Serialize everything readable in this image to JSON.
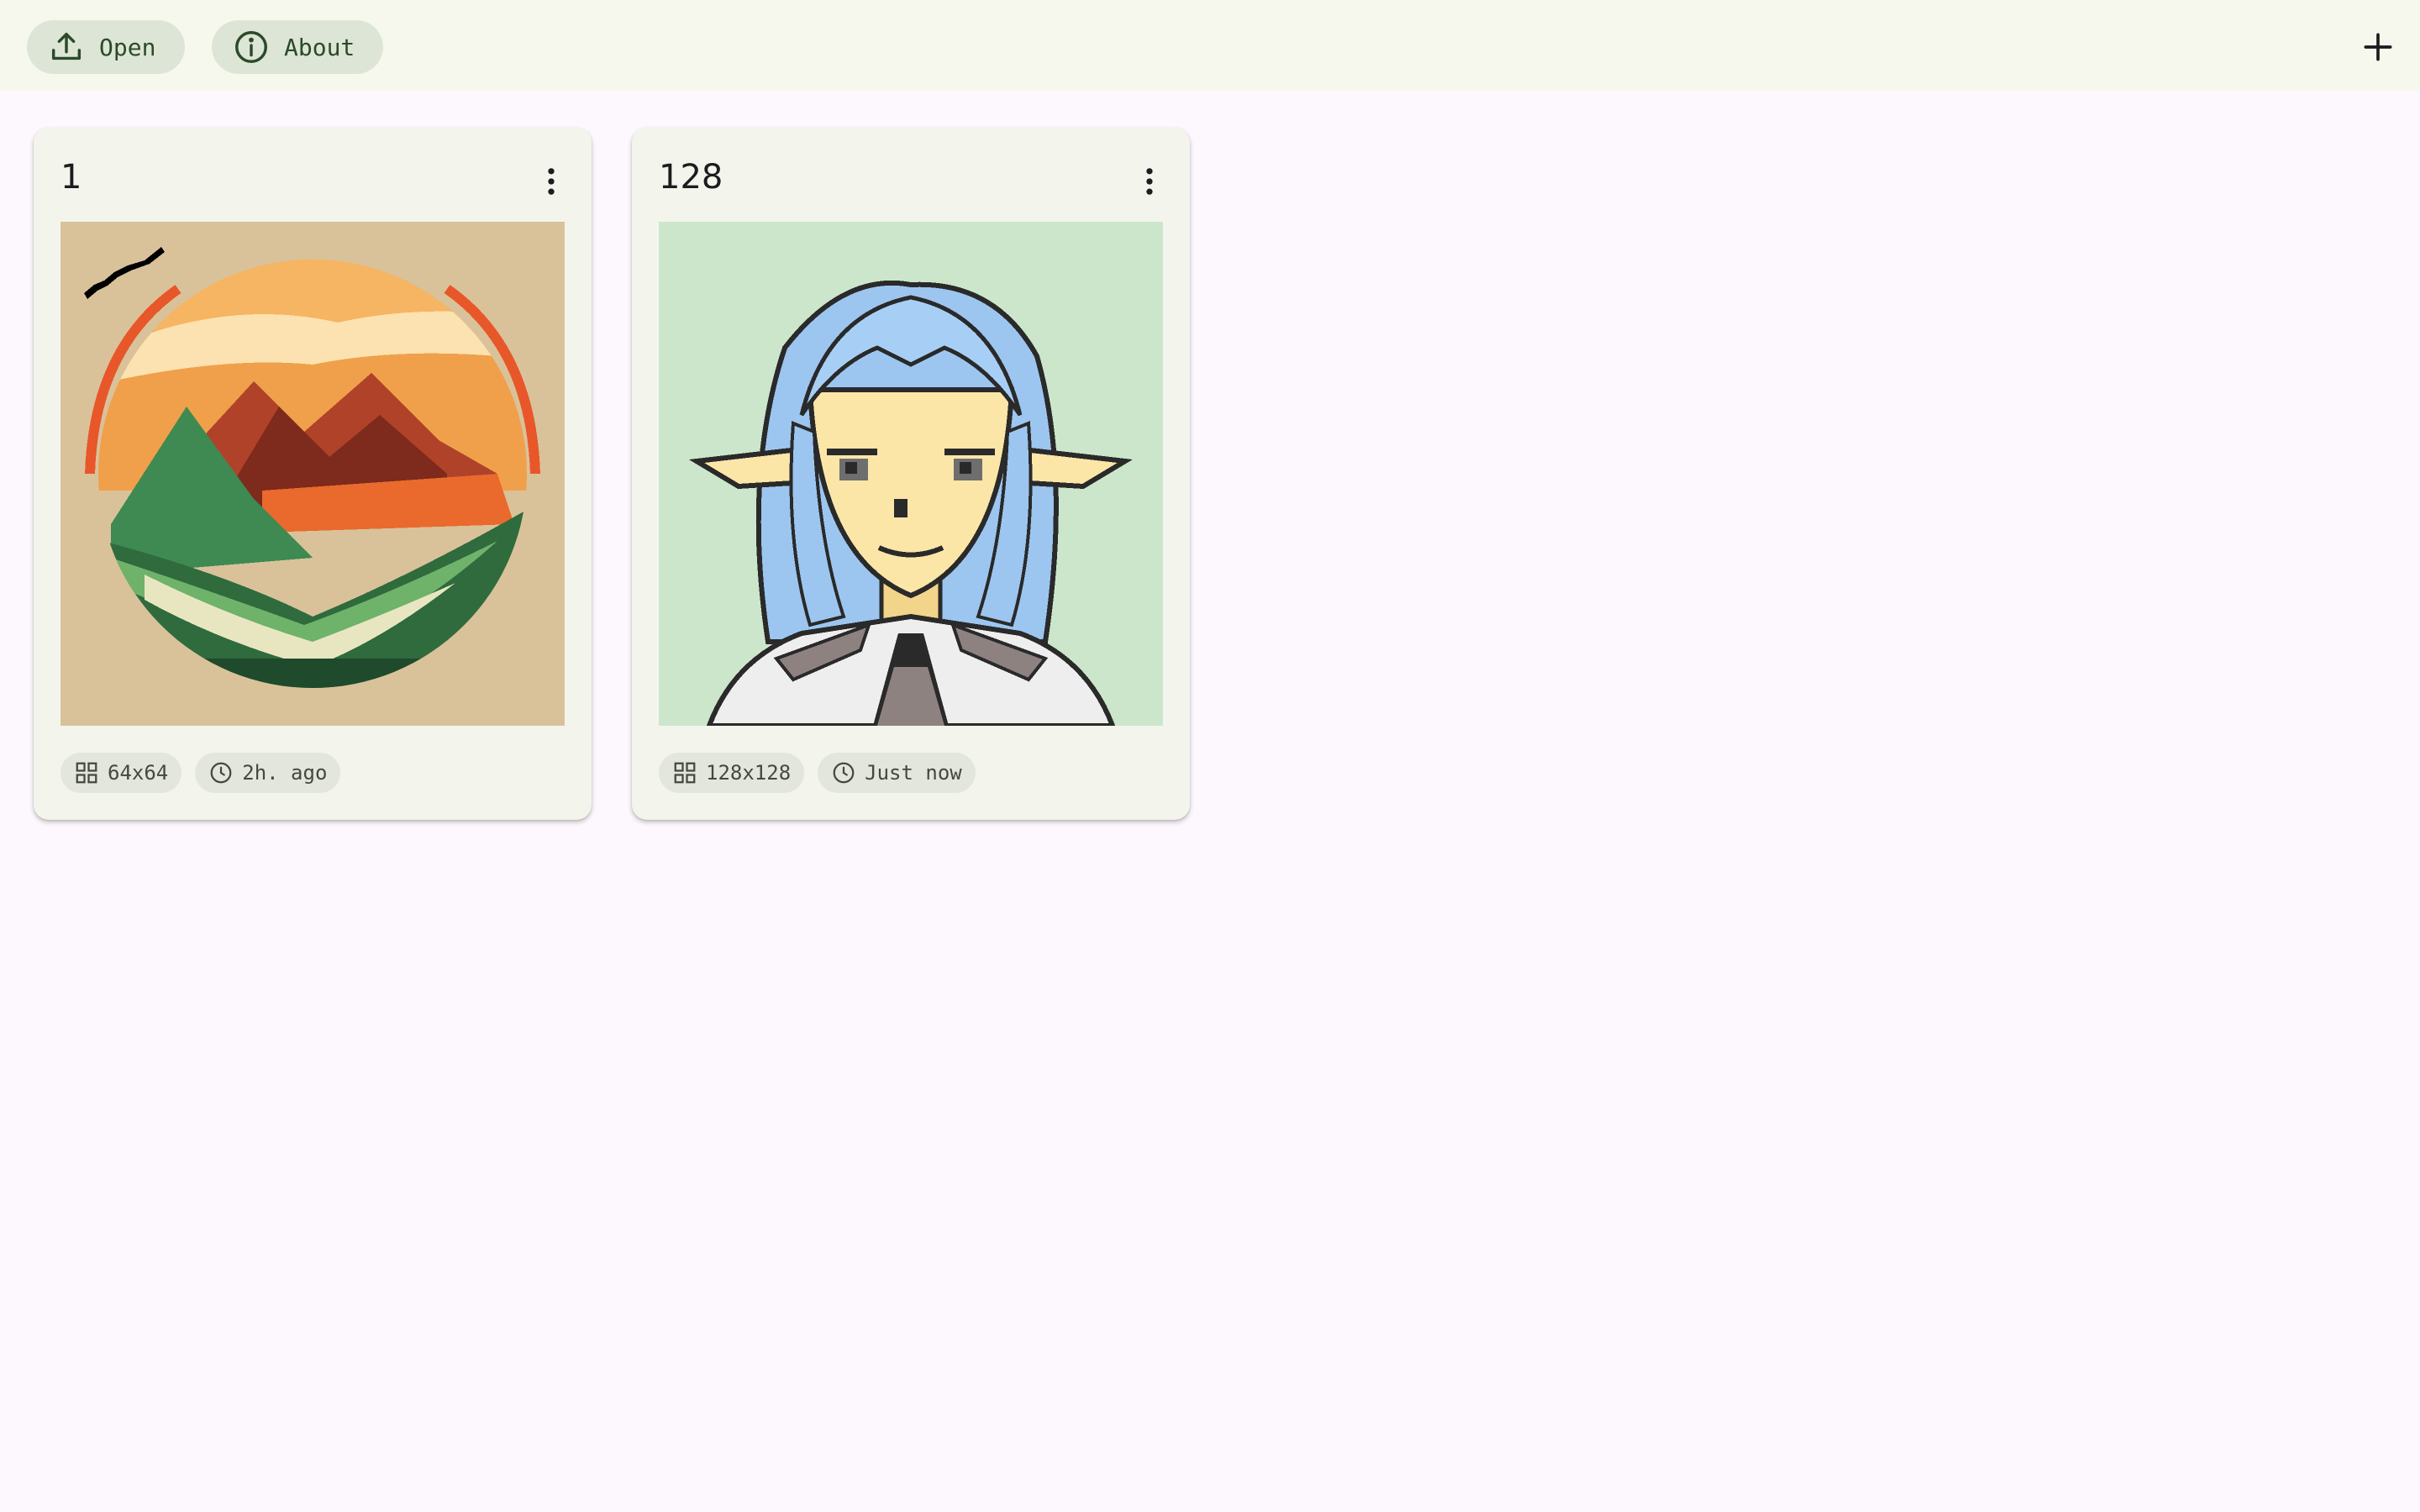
{
  "toolbar": {
    "open_label": "Open",
    "about_label": "About",
    "open_icon": "upload-icon",
    "about_icon": "info-icon",
    "add_icon": "plus-icon"
  },
  "projects": [
    {
      "title": "1",
      "thumbnail": "pixel-art-landscape-orb",
      "size": "64x64",
      "modified": "2h. ago"
    },
    {
      "title": "128",
      "thumbnail": "pixel-art-elf-portrait",
      "size": "128x128",
      "modified": "Just now"
    }
  ],
  "colors": {
    "topbar_bg": "#f6f8ee",
    "page_bg": "#fdf8fd",
    "card_bg": "#f3f5ec",
    "chip_bg": "#dde6d6",
    "accent": "#2c4a2a"
  }
}
